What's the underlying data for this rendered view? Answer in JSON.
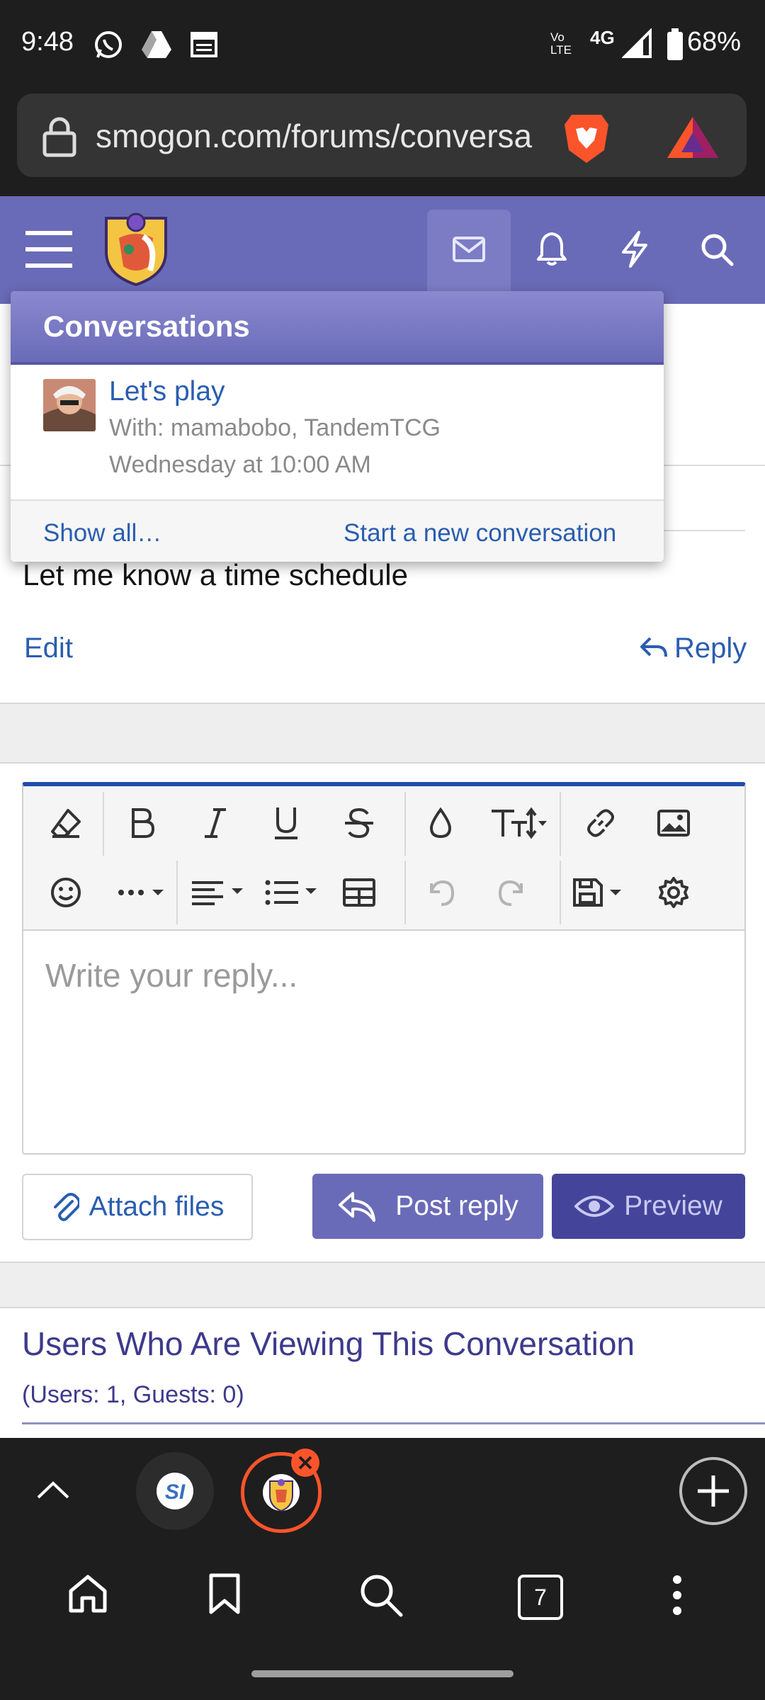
{
  "status_bar": {
    "time": "9:48",
    "network": "4G",
    "volte": "Vo LTE",
    "battery": "68%",
    "icons": [
      "whatsapp-icon",
      "drive-icon",
      "calendar-icon",
      "signal-icon",
      "battery-icon"
    ]
  },
  "browser": {
    "url": "smogon.com/forums/conversa",
    "tab_count": "7",
    "colors": {
      "bar": "#1e1e1e",
      "url_box": "#343434",
      "brave_orange": "#fb542b"
    }
  },
  "site": {
    "header_color": "#6a6bb8",
    "icons": [
      "menu-icon",
      "smogon-logo",
      "mail-icon",
      "bell-icon",
      "bolt-icon",
      "search-icon"
    ]
  },
  "conversations_popup": {
    "title": "Conversations",
    "item": {
      "title": "Let's play",
      "with": "With: mamabobo, TandemTCG",
      "date": "Wednesday at 10:00 AM"
    },
    "show_all": "Show all…",
    "start_new": "Start a new conversation"
  },
  "message": {
    "text": "Let me know a time schedule",
    "edit": "Edit",
    "reply": "Reply"
  },
  "editor": {
    "placeholder": "Write your reply...",
    "toolbar_icons": [
      "eraser-icon",
      "bold-icon",
      "italic-icon",
      "underline-icon",
      "strikethrough-icon",
      "color-drop-icon",
      "font-size-icon",
      "link-icon",
      "image-icon",
      "emoji-icon",
      "more-icon",
      "align-icon",
      "list-icon",
      "table-icon",
      "undo-icon",
      "redo-icon",
      "save-draft-icon",
      "settings-icon"
    ],
    "accent": "#1f4ea8"
  },
  "actions": {
    "attach": "Attach files",
    "post_reply": "Post reply",
    "preview": "Preview",
    "colors": {
      "post": "#6a6bb8",
      "preview": "#44459a"
    }
  },
  "viewers": {
    "title": "Users Who Are Viewing This Conversation",
    "count": "(Users: 1, Guests: 0)"
  }
}
